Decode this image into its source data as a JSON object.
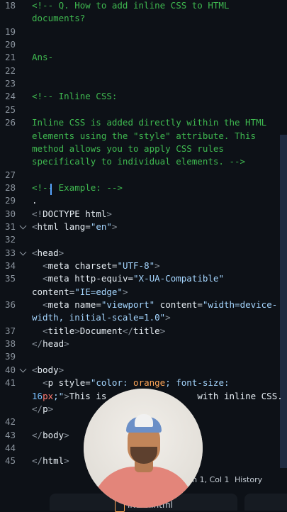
{
  "editor": {
    "lines": [
      {
        "n": "18",
        "html": "<span class=\"cm\">&lt;!-- Q. How to add inline CSS to HTML</span>"
      },
      {
        "n": "",
        "html": "<span class=\"cm\">documents?</span>"
      },
      {
        "n": "19",
        "html": ""
      },
      {
        "n": "20",
        "html": ""
      },
      {
        "n": "21",
        "html": "<span class=\"cm\">Ans-</span>"
      },
      {
        "n": "22",
        "html": ""
      },
      {
        "n": "23",
        "html": ""
      },
      {
        "n": "24",
        "html": "<span class=\"cm\">&lt;!-- Inline CSS:</span>"
      },
      {
        "n": "25",
        "html": ""
      },
      {
        "n": "26",
        "html": "<span class=\"cm\">Inline CSS is added directly within the HTML</span>"
      },
      {
        "n": "",
        "html": "<span class=\"cm\">elements using the \"style\" attribute. This</span>"
      },
      {
        "n": "",
        "html": "<span class=\"cm\">method allows you to apply CSS rules</span>"
      },
      {
        "n": "",
        "html": "<span class=\"cm\">specifically to individual elements. --&gt;</span>"
      },
      {
        "n": "27",
        "html": ""
      },
      {
        "n": "28",
        "html": "<span class=\"cm\">&lt;!-- Example: --&gt;</span>"
      },
      {
        "n": "29",
        "html": "."
      },
      {
        "n": "30",
        "html": "<span class=\"bracket\">&lt;!</span><span class=\"tag\">DOCTYPE</span> <span class=\"attr\">html</span><span class=\"bracket\">&gt;</span>"
      },
      {
        "n": "31",
        "html": "<span class=\"bracket\">&lt;</span><span class=\"tag\">html</span> <span class=\"attr\">lang</span>=<span class=\"str\">\"en\"</span><span class=\"bracket\">&gt;</span>"
      },
      {
        "n": "32",
        "html": ""
      },
      {
        "n": "33",
        "html": "<span class=\"bracket\">&lt;</span><span class=\"tag\">head</span><span class=\"bracket\">&gt;</span>"
      },
      {
        "n": "34",
        "html": "  <span class=\"bracket\">&lt;</span><span class=\"tag\">meta</span> <span class=\"attr\">charset</span>=<span class=\"str\">\"UTF-8\"</span><span class=\"bracket\">&gt;</span>"
      },
      {
        "n": "35",
        "html": "  <span class=\"bracket\">&lt;</span><span class=\"tag\">meta</span> <span class=\"attr\">http-equiv</span>=<span class=\"str\">\"X-UA-Compatible\"</span>"
      },
      {
        "n": "",
        "html": "<span class=\"attr\">content</span>=<span class=\"str\">\"IE=edge\"</span><span class=\"bracket\">&gt;</span>"
      },
      {
        "n": "36",
        "html": "  <span class=\"bracket\">&lt;</span><span class=\"tag\">meta</span> <span class=\"attr\">name</span>=<span class=\"str\">\"viewport\"</span> <span class=\"attr\">content</span>=<span class=\"str\">\"width=device-</span>"
      },
      {
        "n": "",
        "html": "<span class=\"str\">width, initial-scale=1.0\"</span><span class=\"bracket\">&gt;</span>"
      },
      {
        "n": "37",
        "html": "  <span class=\"bracket\">&lt;</span><span class=\"tag\">title</span><span class=\"bracket\">&gt;</span>Document<span class=\"bracket\">&lt;/</span><span class=\"tag\">title</span><span class=\"bracket\">&gt;</span>"
      },
      {
        "n": "38",
        "html": "<span class=\"bracket\">&lt;/</span><span class=\"tag\">head</span><span class=\"bracket\">&gt;</span>"
      },
      {
        "n": "39",
        "html": ""
      },
      {
        "n": "40",
        "html": "<span class=\"bracket\">&lt;</span><span class=\"tag\">body</span><span class=\"bracket\">&gt;</span>"
      },
      {
        "n": "41",
        "html": "  <span class=\"bracket\">&lt;</span><span class=\"tag\">p</span> <span class=\"attr\">style</span>=<span class=\"str\">\"color: </span><span class=\"orange\">orange</span><span class=\"str\">; font-size:</span>"
      },
      {
        "n": "",
        "html": "<span class=\"num\">16</span><span class=\"kw\">px</span><span class=\"str\">;\"</span><span class=\"bracket\">&gt;</span>This is                 with inline CSS."
      },
      {
        "n": "",
        "html": "<span class=\"bracket\">&lt;/</span><span class=\"tag\">p</span><span class=\"bracket\">&gt;</span>"
      },
      {
        "n": "42",
        "html": ""
      },
      {
        "n": "43",
        "html": "<span class=\"bracket\">&lt;/</span><span class=\"tag\">body</span><span class=\"bracket\">&gt;</span>"
      },
      {
        "n": "44",
        "html": ""
      },
      {
        "n": "45",
        "html": "<span class=\"bracket\">&lt;/</span><span class=\"tag\">html</span><span class=\"bracket\">&gt;</span>"
      }
    ]
  },
  "status": {
    "position": "Ln 1, Col 1",
    "history": "History"
  },
  "tab": {
    "file_name": "index.html",
    "more": "⋮"
  },
  "colors": {
    "background": "#0d1117",
    "comment": "#3fb950",
    "string": "#a5d6ff",
    "keyword": "#ff7b72",
    "line_number": "#8b949e"
  }
}
